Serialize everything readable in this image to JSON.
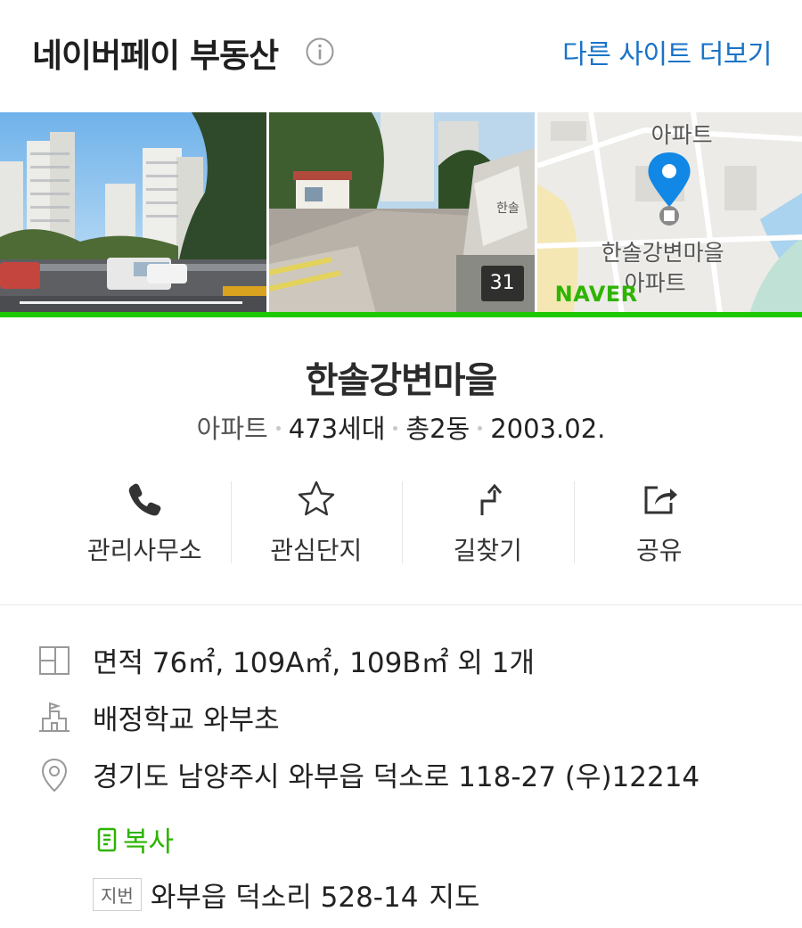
{
  "header": {
    "brand": "네이버페이 부동산",
    "more_link": "다른 사이트 더보기"
  },
  "photos": {
    "count": "31",
    "map_labels": {
      "top": "아파트",
      "name_line1": "한솔강변마을",
      "name_line2": "아파트",
      "logo": "NAVER"
    },
    "colors": {
      "accent_green": "#1ec800",
      "pin_blue": "#1187e6"
    }
  },
  "complex": {
    "name": "한솔강변마을",
    "type": "아파트",
    "households": "473세대",
    "buildings": "총2동",
    "date": "2003.02."
  },
  "actions": [
    {
      "label": "관리사무소",
      "icon": "phone-icon"
    },
    {
      "label": "관심단지",
      "icon": "star-icon"
    },
    {
      "label": "길찾기",
      "icon": "directions-icon"
    },
    {
      "label": "공유",
      "icon": "share-icon"
    }
  ],
  "details": {
    "area": "면적 76㎡, 109A㎡, 109B㎡ 외 1개",
    "school_label": "배정학교",
    "school_link": "와부초",
    "address": "경기도 남양주시 와부읍 덕소로 118-27 (우)12214",
    "copy_label": "복사",
    "jibeon_tag": "지번",
    "jibeon_address": "와부읍 덕소리 528-14",
    "map_link": "지도"
  }
}
